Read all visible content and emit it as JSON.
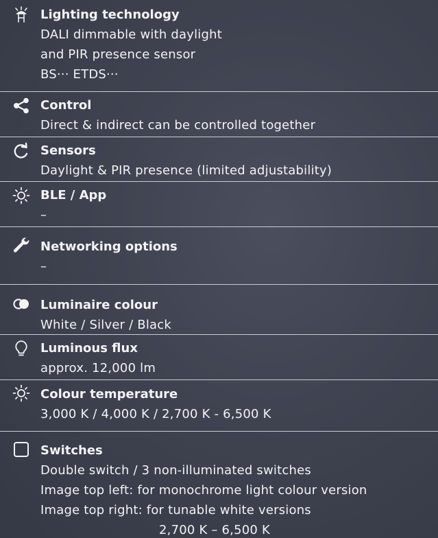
{
  "items": [
    {
      "icon": "lamp-icon",
      "title": "Lighting technology",
      "lines": [
        "DALI dimmable with daylight",
        "and PIR presence sensor",
        "BS··· ETDS···"
      ]
    },
    {
      "icon": "share-icon",
      "title": "Control",
      "lines": [
        "Direct & indirect can be controlled together"
      ]
    },
    {
      "icon": "refresh-icon",
      "title": "Sensors",
      "lines": [
        "Daylight & PIR presence (limited adjustability)"
      ]
    },
    {
      "icon": "sun-icon",
      "title": "BLE / App",
      "lines": [
        "–"
      ]
    },
    {
      "icon": "wrench-icon",
      "title": "Networking options",
      "lines": [
        "–"
      ]
    },
    {
      "icon": "colour-circles-icon",
      "title": "Luminaire colour",
      "lines": [
        "White / Silver / Black"
      ]
    },
    {
      "icon": "bulb-icon",
      "title": "Luminous flux",
      "lines": [
        "approx. 12,000 lm"
      ]
    },
    {
      "icon": "sun-icon",
      "title": "Colour temperature",
      "lines": [
        "3,000 K / 4,000 K / 2,700 K - 6,500 K"
      ]
    },
    {
      "icon": "switch-icon",
      "title": "Switches",
      "lines": [
        "Double switch / 3 non-illuminated switches",
        "Image top left: for monochrome light colour version",
        "Image top right: for tunable white versions",
        "2,700 K – 6,500 K"
      ]
    }
  ]
}
